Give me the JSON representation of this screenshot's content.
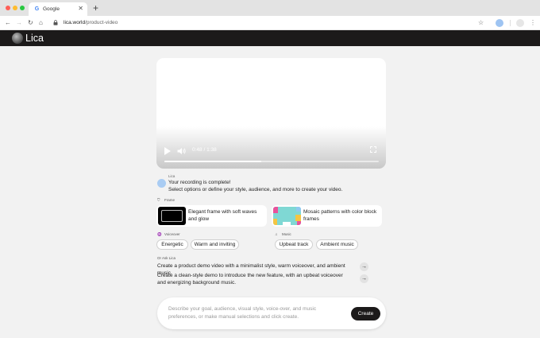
{
  "browser": {
    "tab_title": "Google",
    "tab_favicon": "google-favicon",
    "url_host": "lica.world",
    "url_path": "/product-video"
  },
  "app": {
    "name": "Lica",
    "brand_color": "#1c1a1a"
  },
  "video": {
    "time": "0:48 / 1:38",
    "progress": 0.45
  },
  "agent": {
    "name": "Lica",
    "message_line1": "Your recording is complete!",
    "message_line2": "Select options or define your style, audience, and more to create your video."
  },
  "frame": {
    "label": "Frame",
    "options": [
      {
        "label": "Elegant frame with soft waves and glow"
      },
      {
        "label": "Mosaic patterns with color block frames"
      }
    ]
  },
  "voiceover": {
    "label": "Voiceover",
    "options": [
      "Energetic",
      "Warm and inviting"
    ]
  },
  "music": {
    "label": "Music",
    "options": [
      "Upbeat track",
      "Ambient music"
    ]
  },
  "ask": {
    "label": "Or Ask Lica",
    "suggestions": [
      "Create a product demo video with a minimalist style, warm voiceover, and ambient music.",
      "Create a clean-style demo to introduce the new feature, with an upbeat voiceover and energizing background music."
    ]
  },
  "composer": {
    "placeholder": "Describe your goal, audience, visual style, voice-over, and music preferences, or make manual selections and click create.",
    "create_label": "Create"
  }
}
